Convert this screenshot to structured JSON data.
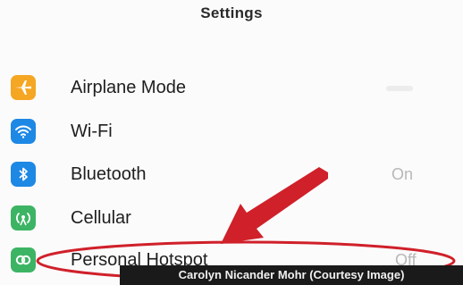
{
  "header": {
    "title": "Settings"
  },
  "settings": {
    "items": [
      {
        "label": "Airplane Mode",
        "value": "",
        "icon": "airplane-icon",
        "icon_color": "#f5a623"
      },
      {
        "label": "Wi-Fi",
        "value": "",
        "icon": "wifi-icon",
        "icon_color": "#1e88e5"
      },
      {
        "label": "Bluetooth",
        "value": "On",
        "icon": "bluetooth-icon",
        "icon_color": "#1e88e5"
      },
      {
        "label": "Cellular",
        "value": "",
        "icon": "cellular-icon",
        "icon_color": "#3cb464"
      },
      {
        "label": "Personal Hotspot",
        "value": "Off",
        "icon": "hotspot-icon",
        "icon_color": "#3cb464"
      }
    ]
  },
  "annotation": {
    "color": "#d0202a",
    "arrow_target": "Personal Hotspot"
  },
  "caption": {
    "text": "Carolyn Nicander Mohr (Courtesy Image)"
  }
}
